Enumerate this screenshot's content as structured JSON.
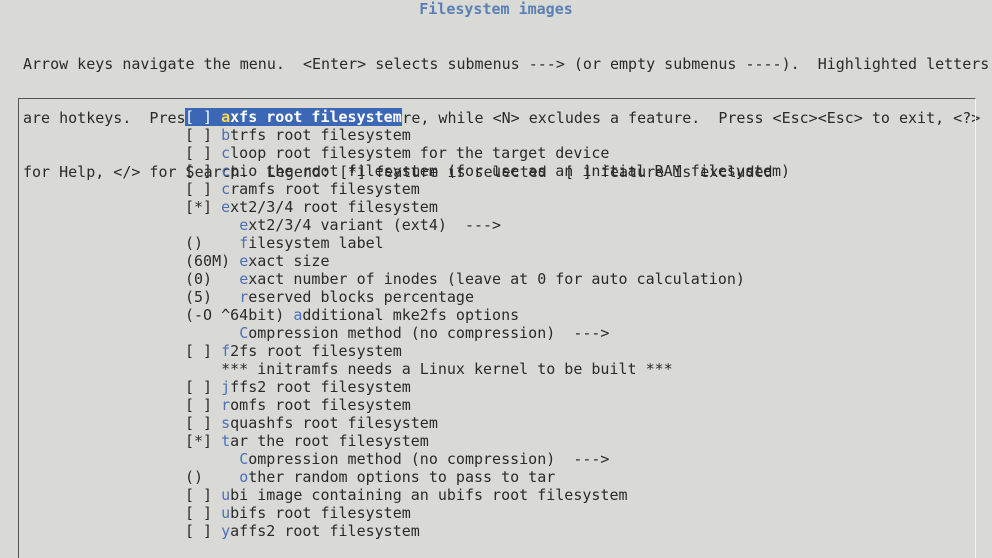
{
  "title": "Filesystem images",
  "help_lines": [
    "Arrow keys navigate the menu.  <Enter> selects submenus ---> (or empty submenus ----).  Highlighted letters",
    "are hotkeys.  Pressing <Y> selects a feature, while <N> excludes a feature.  Press <Esc><Esc> to exit, <?>",
    "for Help, </> for Search.  Legend: [*] feature is selected  [ ] feature is excluded"
  ],
  "menu": {
    "items": [
      {
        "prefix": "[ ] ",
        "indent": "",
        "hotkey": "a",
        "rest": "xfs root filesystem",
        "selected": true
      },
      {
        "prefix": "[ ] ",
        "indent": "",
        "hotkey": "b",
        "rest": "trfs root filesystem"
      },
      {
        "prefix": "[ ] ",
        "indent": "",
        "hotkey": "c",
        "rest": "loop root filesystem for the target device"
      },
      {
        "prefix": "[ ] ",
        "indent": "",
        "hotkey": "c",
        "rest": "pio the root filesystem (for use as an initial RAM filesystem)"
      },
      {
        "prefix": "[ ] ",
        "indent": "",
        "hotkey": "c",
        "rest": "ramfs root filesystem"
      },
      {
        "prefix": "[*] ",
        "indent": "",
        "hotkey": "e",
        "rest": "xt2/3/4 root filesystem"
      },
      {
        "prefix": "    ",
        "indent": "  ",
        "hotkey": "e",
        "rest": "xt2/3/4 variant (ext4)  --->"
      },
      {
        "prefix": "()  ",
        "indent": "  ",
        "hotkey": "f",
        "rest": "ilesystem label"
      },
      {
        "prefix": "(60M) ",
        "indent": "",
        "hotkey": "e",
        "rest": "xact size"
      },
      {
        "prefix": "(0) ",
        "indent": "  ",
        "hotkey": "e",
        "rest": "xact number of inodes (leave at 0 for auto calculation)"
      },
      {
        "prefix": "(5) ",
        "indent": "  ",
        "hotkey": "r",
        "rest": "eserved blocks percentage"
      },
      {
        "prefix": "(-O ^64bit) ",
        "indent": "",
        "hotkey": "a",
        "rest": "dditional mke2fs options"
      },
      {
        "prefix": "    ",
        "indent": "  ",
        "hotkey": "C",
        "rest": "ompression method (no compression)  --->"
      },
      {
        "prefix": "[ ] ",
        "indent": "",
        "hotkey": "f",
        "rest": "2fs root filesystem"
      },
      {
        "prefix": "    ",
        "indent": "",
        "hotkey": "",
        "rest": "*** initramfs needs a Linux kernel to be built ***"
      },
      {
        "prefix": "[ ] ",
        "indent": "",
        "hotkey": "j",
        "rest": "ffs2 root filesystem"
      },
      {
        "prefix": "[ ] ",
        "indent": "",
        "hotkey": "r",
        "rest": "omfs root filesystem"
      },
      {
        "prefix": "[ ] ",
        "indent": "",
        "hotkey": "s",
        "rest": "quashfs root filesystem"
      },
      {
        "prefix": "[*] ",
        "indent": "",
        "hotkey": "t",
        "rest": "ar the root filesystem"
      },
      {
        "prefix": "    ",
        "indent": "  ",
        "hotkey": "C",
        "rest": "ompression method (no compression)  --->"
      },
      {
        "prefix": "()  ",
        "indent": "  ",
        "hotkey": "o",
        "rest": "ther random options to pass to tar"
      },
      {
        "prefix": "[ ] ",
        "indent": "",
        "hotkey": "u",
        "rest": "bi image containing an ubifs root filesystem"
      },
      {
        "prefix": "[ ] ",
        "indent": "",
        "hotkey": "u",
        "rest": "bifs root filesystem"
      },
      {
        "prefix": "[ ] ",
        "indent": "",
        "hotkey": "y",
        "rest": "affs2 root filesystem"
      }
    ]
  },
  "colors": {
    "background": "#d9d9d6",
    "title": "#5a7fb5",
    "hotkey": "#4a70b8",
    "selection_bg": "#3b67b5",
    "selection_hotkey": "#ffd84a"
  }
}
